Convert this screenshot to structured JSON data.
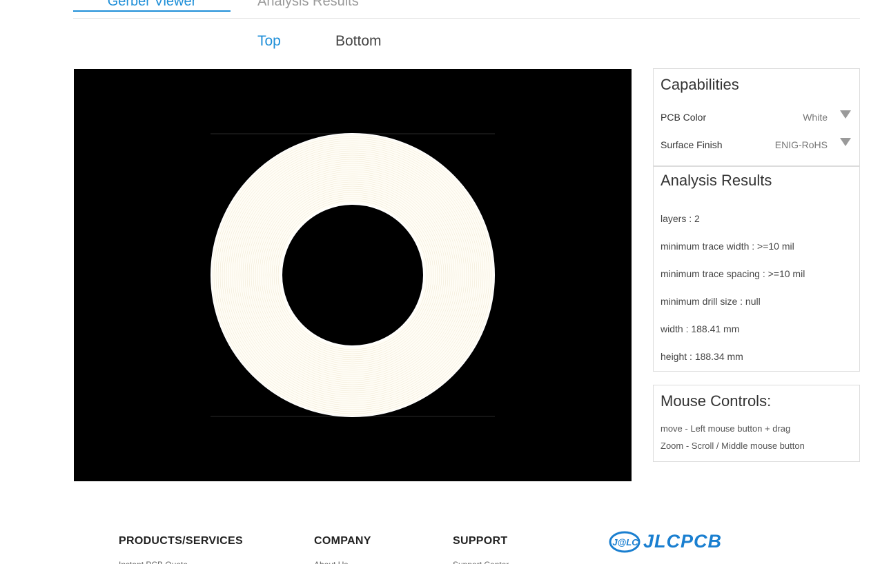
{
  "tabs": {
    "active": "Gerber Viewer",
    "inactive": "Analysis Results"
  },
  "layer_tabs": {
    "top": "Top",
    "bottom": "Bottom"
  },
  "viewer": {
    "background": "#000000",
    "board_color": "#fffdf6"
  },
  "capabilities": {
    "title": "Capabilities",
    "pcb_color_label": "PCB Color",
    "pcb_color_value": "White",
    "surface_finish_label": "Surface Finish",
    "surface_finish_value": "ENIG-RoHS"
  },
  "analysis": {
    "title": "Analysis Results",
    "rows": [
      "layers : 2",
      "minimum trace width : >=10 mil",
      "minimum trace spacing : >=10 mil",
      "minimum drill size : null",
      "width : 188.41 mm",
      "height : 188.34 mm"
    ]
  },
  "mouse": {
    "title": "Mouse Controls:",
    "move": "move - Left mouse button + drag",
    "zoom": "Zoom - Scroll / Middle mouse button"
  },
  "footer": {
    "col1": "PRODUCTS/SERVICES",
    "col2": "COMPANY",
    "col3": "SUPPORT",
    "col1_item": "Instant PCB Quote",
    "col2_item": "About Us",
    "col3_item": "Support Center",
    "logo_mark": "J@LC",
    "logo_text": "JLCPCB"
  },
  "colors": {
    "accent": "#1f8fd8",
    "brand": "#1a7fd0"
  }
}
